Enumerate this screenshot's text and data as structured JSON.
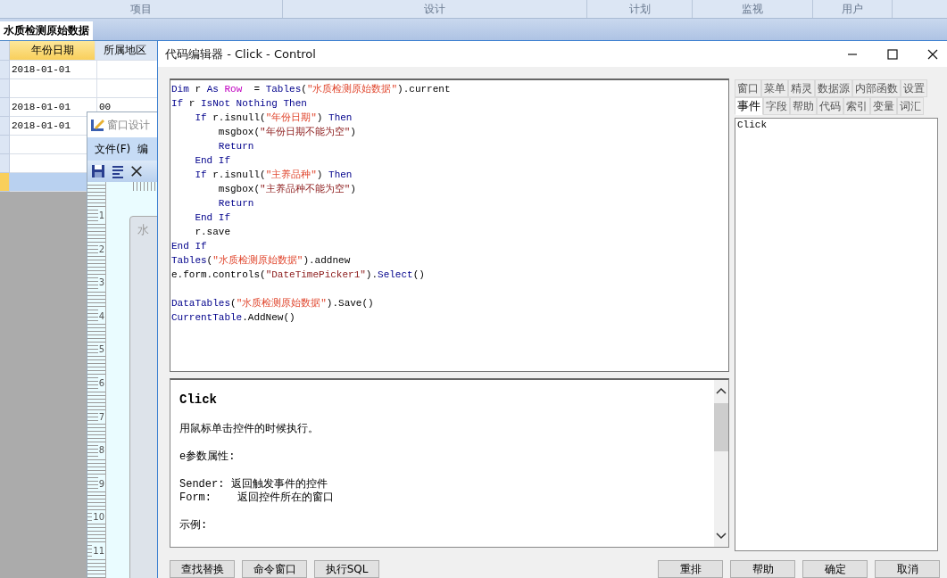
{
  "app": {
    "ribbon_tabs": [
      "项目",
      "设计",
      "计划",
      "监视",
      "用户"
    ],
    "document_tab": {
      "label": "水质检测原始数据",
      "selected": true
    },
    "grid": {
      "columns": [
        {
          "label": "年份日期",
          "selected": true
        },
        {
          "label": "所属地区",
          "selected": false
        }
      ],
      "rows": [
        {
          "date": "2018-01-01",
          "selected": false
        },
        {
          "selected": false
        },
        {
          "date": "2018-01-01",
          "region": "00",
          "selected": false
        },
        {
          "date": "2018-01-01",
          "selected": false
        },
        {
          "selected": false
        },
        {
          "selected": false
        },
        {
          "selected": true
        }
      ]
    }
  },
  "designer_window": {
    "title": "窗口设计",
    "menu": [
      "文件(F)",
      "编"
    ],
    "ruler_marks": [
      "1",
      "2",
      "3",
      "4",
      "5",
      "6",
      "7",
      "8",
      "9",
      "10",
      "11"
    ],
    "form_title": "水"
  },
  "code_editor": {
    "title": "代码编辑器 - Click - Control",
    "code_lines": [
      {
        "kind": "code",
        "tokens": [
          {
            "kind": "kw",
            "text": "Dim"
          },
          {
            "kind": "plain",
            "text": " r "
          },
          {
            "kind": "kw",
            "text": "As "
          },
          {
            "kind": "type",
            "text": "Row"
          },
          {
            "kind": "plain",
            "text": "  = "
          },
          {
            "kind": "kw",
            "text": "Tables"
          },
          {
            "kind": "plain",
            "text": "("
          },
          {
            "kind": "str",
            "text": "\"水质检测原始数据\""
          },
          {
            "kind": "plain",
            "text": ").current"
          }
        ]
      },
      {
        "kind": "code",
        "tokens": [
          {
            "kind": "kw",
            "text": "If"
          },
          {
            "kind": "plain",
            "text": " r "
          },
          {
            "kind": "kw",
            "text": "IsNot Nothing Then"
          }
        ]
      },
      {
        "kind": "code",
        "tokens": [
          {
            "kind": "kw",
            "text": "    If"
          },
          {
            "kind": "plain",
            "text": " r.isnull("
          },
          {
            "kind": "str",
            "text": "\"年份日期\""
          },
          {
            "kind": "plain",
            "text": ") "
          },
          {
            "kind": "kw",
            "text": "Then"
          }
        ]
      },
      {
        "kind": "code",
        "tokens": [
          {
            "kind": "plain",
            "text": "        msgbox("
          },
          {
            "kind": "str2",
            "text": "\"年份日期不能为空\""
          },
          {
            "kind": "plain",
            "text": ")"
          }
        ]
      },
      {
        "kind": "code",
        "tokens": [
          {
            "kind": "kw",
            "text": "        Return"
          }
        ]
      },
      {
        "kind": "code",
        "tokens": [
          {
            "kind": "kw",
            "text": "    End If"
          }
        ]
      },
      {
        "kind": "code",
        "tokens": [
          {
            "kind": "kw",
            "text": "    If"
          },
          {
            "kind": "plain",
            "text": " r.isnull("
          },
          {
            "kind": "str",
            "text": "\"主养品种\""
          },
          {
            "kind": "plain",
            "text": ") "
          },
          {
            "kind": "kw",
            "text": "Then"
          }
        ]
      },
      {
        "kind": "code",
        "tokens": [
          {
            "kind": "plain",
            "text": "        msgbox("
          },
          {
            "kind": "str2",
            "text": "\"主养品种不能为空\""
          },
          {
            "kind": "plain",
            "text": ")"
          }
        ]
      },
      {
        "kind": "code",
        "tokens": [
          {
            "kind": "kw",
            "text": "        Return"
          }
        ]
      },
      {
        "kind": "code",
        "tokens": [
          {
            "kind": "kw",
            "text": "    End If"
          }
        ]
      },
      {
        "kind": "code",
        "tokens": [
          {
            "kind": "plain",
            "text": "    r.save"
          }
        ]
      },
      {
        "kind": "code",
        "tokens": [
          {
            "kind": "kw",
            "text": "End If"
          }
        ]
      },
      {
        "kind": "code",
        "tokens": [
          {
            "kind": "kw",
            "text": "Tables"
          },
          {
            "kind": "plain",
            "text": "("
          },
          {
            "kind": "str",
            "text": "\"水质检测原始数据\""
          },
          {
            "kind": "plain",
            "text": ").addnew"
          }
        ]
      },
      {
        "kind": "code",
        "tokens": [
          {
            "kind": "plain",
            "text": "e.form.controls("
          },
          {
            "kind": "str2",
            "text": "\"DateTimePicker1\""
          },
          {
            "kind": "plain",
            "text": ")."
          },
          {
            "kind": "kw",
            "text": "Select"
          },
          {
            "kind": "plain",
            "text": "()"
          }
        ]
      },
      {
        "kind": "blank"
      },
      {
        "kind": "code",
        "tokens": [
          {
            "kind": "kw",
            "text": "DataTables"
          },
          {
            "kind": "plain",
            "text": "("
          },
          {
            "kind": "str",
            "text": "\"水质检测原始数据\""
          },
          {
            "kind": "plain",
            "text": ").Save()"
          }
        ]
      },
      {
        "kind": "code",
        "tokens": [
          {
            "kind": "kw",
            "text": "CurrentTable"
          },
          {
            "kind": "plain",
            "text": ".AddNew()"
          }
        ]
      }
    ],
    "help": {
      "title": "Click",
      "paragraphs": [
        [
          "用鼠标单击控件的时候执行。"
        ],
        [
          "e参数属性:"
        ],
        [
          "Sender: 返回触发事件的控件",
          "Form:    返回控件所在的窗口"
        ],
        [
          "示例:"
        ]
      ]
    },
    "side_tabs": [
      [
        {
          "label": "窗口",
          "selected": false
        },
        {
          "label": "菜单",
          "selected": false
        },
        {
          "label": "精灵",
          "selected": false
        },
        {
          "label": "数据源",
          "selected": false
        },
        {
          "label": "内部函数",
          "selected": false
        },
        {
          "label": "设置",
          "selected": false
        }
      ],
      [
        {
          "label": "事件",
          "selected": true
        },
        {
          "label": "字段",
          "selected": false
        },
        {
          "label": "帮助",
          "selected": false
        },
        {
          "label": "代码",
          "selected": false
        },
        {
          "label": "索引",
          "selected": false
        },
        {
          "label": "变量",
          "selected": false
        },
        {
          "label": "词汇",
          "selected": false
        }
      ]
    ],
    "events": [
      "Click"
    ],
    "buttons_left": [
      "查找替换",
      "命令窗口",
      "执行SQL"
    ],
    "buttons_right": [
      "重排",
      "帮助",
      "确定",
      "取消"
    ]
  }
}
